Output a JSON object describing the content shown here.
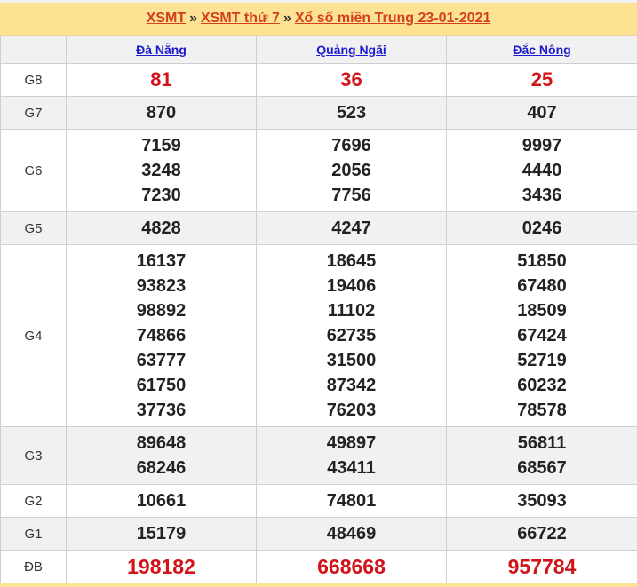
{
  "breadcrumb": {
    "items": [
      "XSMT",
      "XSMT thứ 7",
      "Xổ số miền Trung 23-01-2021"
    ],
    "separator": "»"
  },
  "provinces": [
    "Đà Nẵng",
    "Quảng Ngãi",
    "Đắc Nông"
  ],
  "prizes": [
    {
      "label": "G8",
      "values": [
        [
          "81"
        ],
        [
          "36"
        ],
        [
          "25"
        ]
      ]
    },
    {
      "label": "G7",
      "values": [
        [
          "870"
        ],
        [
          "523"
        ],
        [
          "407"
        ]
      ]
    },
    {
      "label": "G6",
      "values": [
        [
          "7159",
          "3248",
          "7230"
        ],
        [
          "7696",
          "2056",
          "7756"
        ],
        [
          "9997",
          "4440",
          "3436"
        ]
      ]
    },
    {
      "label": "G5",
      "values": [
        [
          "4828"
        ],
        [
          "4247"
        ],
        [
          "0246"
        ]
      ]
    },
    {
      "label": "G4",
      "values": [
        [
          "16137",
          "93823",
          "98892",
          "74866",
          "63777",
          "61750",
          "37736"
        ],
        [
          "18645",
          "19406",
          "11102",
          "62735",
          "31500",
          "87342",
          "76203"
        ],
        [
          "51850",
          "67480",
          "18509",
          "67424",
          "52719",
          "60232",
          "78578"
        ]
      ]
    },
    {
      "label": "G3",
      "values": [
        [
          "89648",
          "68246"
        ],
        [
          "49897",
          "43411"
        ],
        [
          "56811",
          "68567"
        ]
      ]
    },
    {
      "label": "G2",
      "values": [
        [
          "10661"
        ],
        [
          "74801"
        ],
        [
          "35093"
        ]
      ]
    },
    {
      "label": "G1",
      "values": [
        [
          "15179"
        ],
        [
          "48469"
        ],
        [
          "66722"
        ]
      ]
    },
    {
      "label": "ĐB",
      "values": [
        [
          "198182"
        ],
        [
          "668668"
        ],
        [
          "957784"
        ]
      ]
    }
  ],
  "colors": {
    "title_bg": "#fde293",
    "link_red": "#d2401c",
    "link_blue": "#1c1ad0",
    "highlight_red": "#d0141a"
  }
}
